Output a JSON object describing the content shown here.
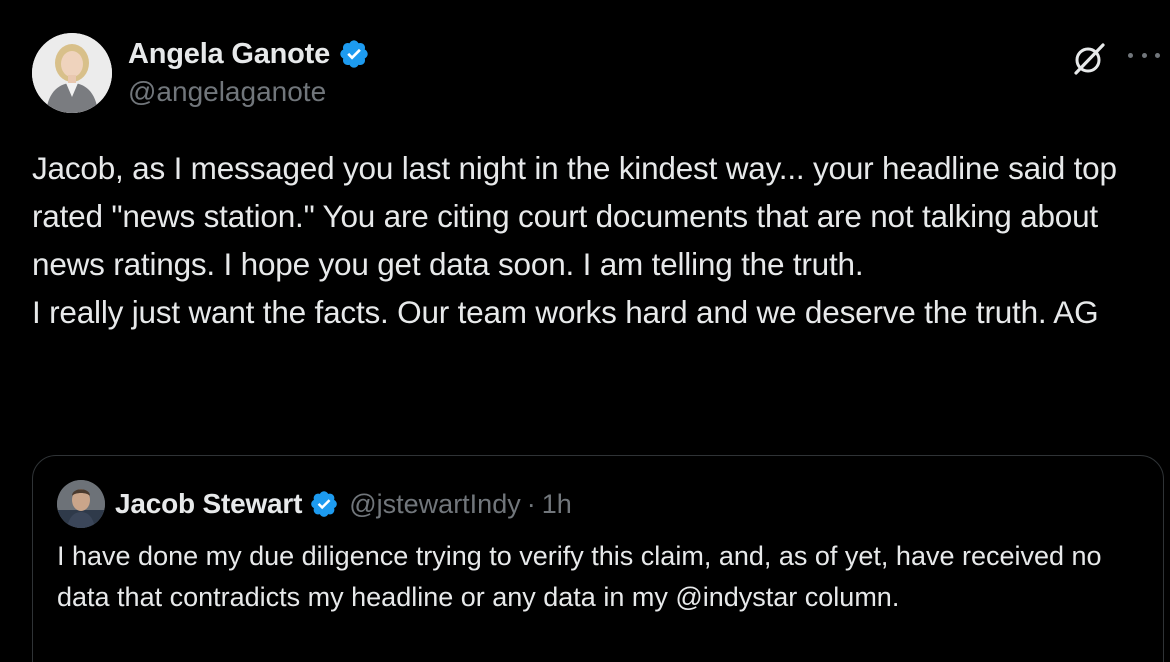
{
  "post": {
    "author": {
      "display_name": "Angela Ganote",
      "handle": "@angelaganote",
      "verified": true
    },
    "text": "Jacob, as I messaged you last night in the kindest way... your headline said top rated \"news station.\" You are citing court documents that are not talking about news ratings. I hope you get data soon. I am telling the truth.\nI really just want the facts. Our team works hard and we deserve the truth. AG",
    "icons": {
      "grok": "grok-icon",
      "more": "more-options-icon",
      "verified": "verified-badge-icon"
    }
  },
  "quoted_post": {
    "author": {
      "display_name": "Jacob Stewart",
      "handle": "@jstewartIndy",
      "verified": true
    },
    "separator": "·",
    "time": "1h",
    "text": "I have done my due diligence trying to verify this claim, and, as of yet, have received no data that contradicts my headline or any data in my @indystar column."
  },
  "colors": {
    "background": "#000000",
    "text_primary": "#e7e9ea",
    "text_secondary": "#71767b",
    "verified_blue": "#1d9bf0",
    "border": "#2f3336"
  }
}
